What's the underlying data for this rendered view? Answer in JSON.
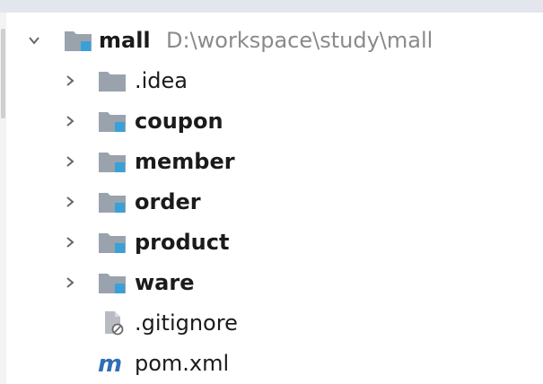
{
  "tree": {
    "root": {
      "name": "mall",
      "path": "D:\\workspace\\study\\mall",
      "icon": "module-folder-icon",
      "expanded": true
    },
    "children": [
      {
        "name": ".idea",
        "type": "folder",
        "icon": "folder-icon",
        "bold": false
      },
      {
        "name": "coupon",
        "type": "module",
        "icon": "module-folder-icon",
        "bold": true
      },
      {
        "name": "member",
        "type": "module",
        "icon": "module-folder-icon",
        "bold": true
      },
      {
        "name": "order",
        "type": "module",
        "icon": "module-folder-icon",
        "bold": true
      },
      {
        "name": "product",
        "type": "module",
        "icon": "module-folder-icon",
        "bold": true
      },
      {
        "name": "ware",
        "type": "module",
        "icon": "module-folder-icon",
        "bold": true
      },
      {
        "name": ".gitignore",
        "type": "file",
        "icon": "gitignore-file-icon",
        "bold": false
      },
      {
        "name": "pom.xml",
        "type": "file",
        "icon": "maven-icon",
        "bold": false
      }
    ]
  },
  "colors": {
    "folder": "#9aa3ad",
    "module_badge": "#3aa0d8",
    "maven": "#2f6fb5",
    "chevron": "#666666",
    "path_text": "#8a8a8a"
  }
}
